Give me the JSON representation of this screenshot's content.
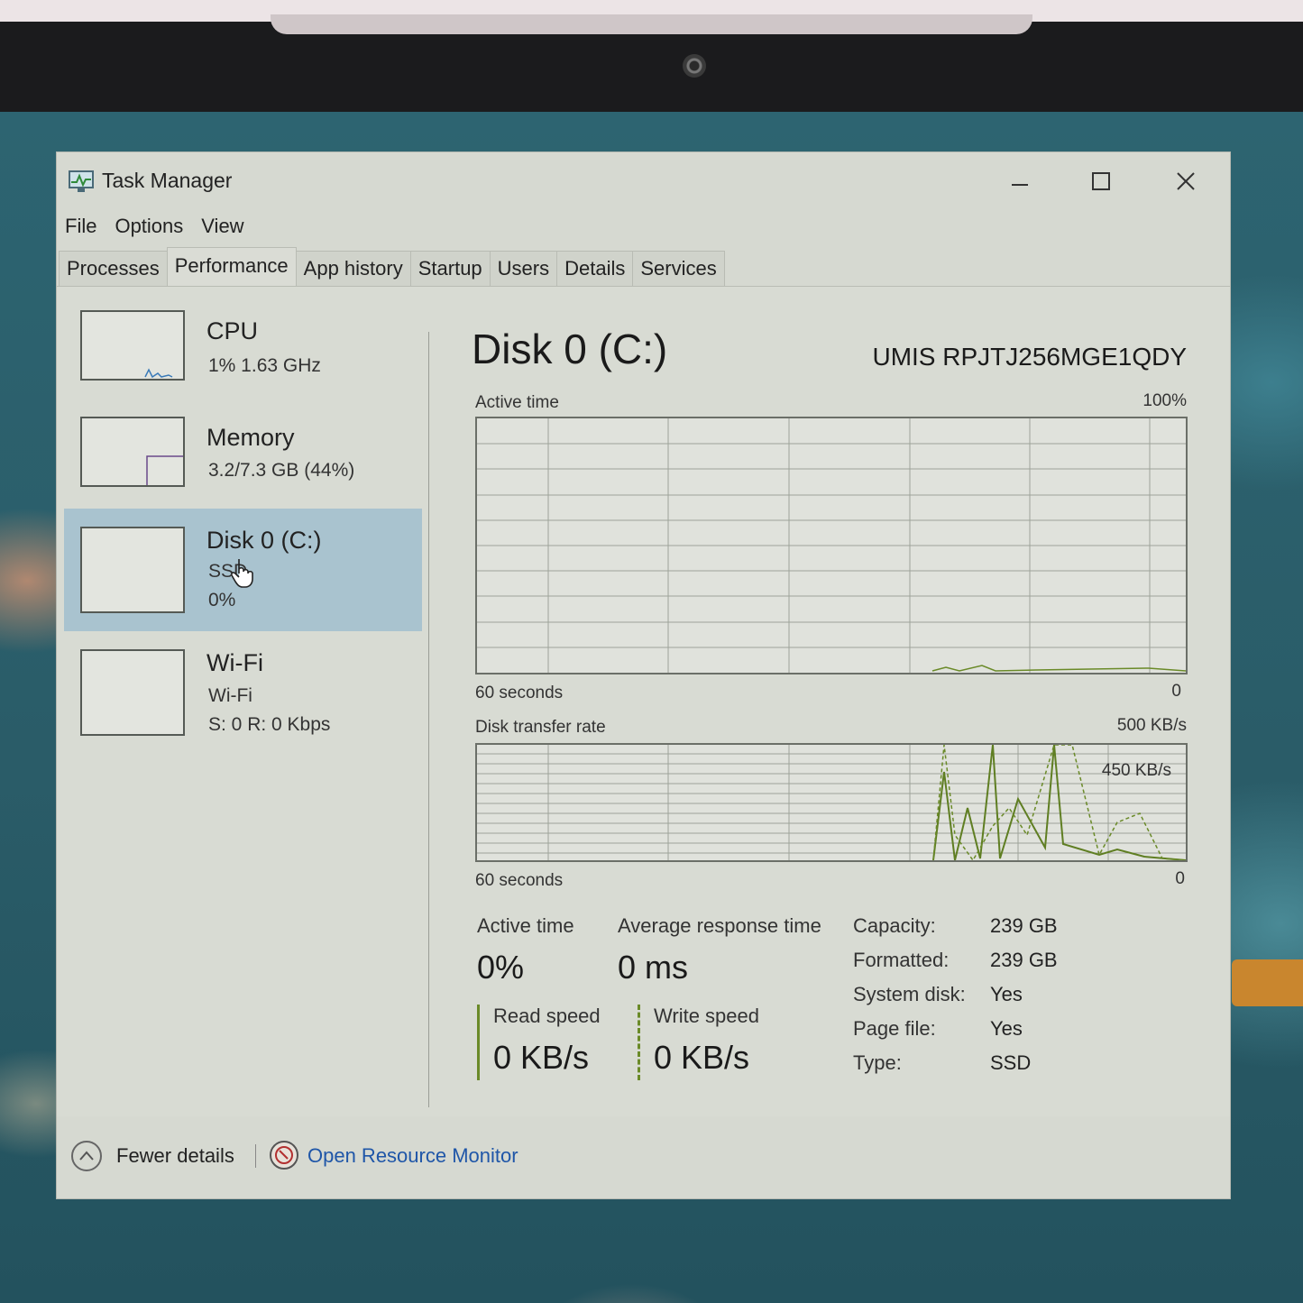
{
  "window": {
    "title": "Task Manager"
  },
  "menu": [
    "File",
    "Options",
    "View"
  ],
  "tabs": [
    {
      "label": "Processes"
    },
    {
      "label": "Performance",
      "active": true
    },
    {
      "label": "App history"
    },
    {
      "label": "Startup"
    },
    {
      "label": "Users"
    },
    {
      "label": "Details"
    },
    {
      "label": "Services"
    }
  ],
  "sidebar": [
    {
      "title": "CPU",
      "line1": "1%  1.63 GHz",
      "line2": ""
    },
    {
      "title": "Memory",
      "line1": "3.2/7.3 GB (44%)",
      "line2": ""
    },
    {
      "title": "Disk 0 (C:)",
      "line1": "SSD",
      "line2": "0%",
      "selected": true
    },
    {
      "title": "Wi-Fi",
      "line1": "Wi-Fi",
      "line2": "S: 0  R: 0 Kbps"
    }
  ],
  "disk": {
    "title": "Disk 0 (C:)",
    "model": "UMIS RPJTJ256MGE1QDY",
    "active_chart": {
      "label": "Active time",
      "max": "100%",
      "time": "60 seconds",
      "min": "0"
    },
    "transfer_chart": {
      "label": "Disk transfer rate",
      "max": "500 KB/s",
      "marker": "450 KB/s",
      "time": "60 seconds",
      "min": "0"
    },
    "stats": {
      "active_time_label": "Active time",
      "active_time_value": "0%",
      "avg_resp_label": "Average response time",
      "avg_resp_value": "0 ms",
      "read_label": "Read speed",
      "read_value": "0 KB/s",
      "write_label": "Write speed",
      "write_value": "0 KB/s"
    },
    "properties": [
      {
        "key": "Capacity:",
        "value": "239 GB"
      },
      {
        "key": "Formatted:",
        "value": "239 GB"
      },
      {
        "key": "System disk:",
        "value": "Yes"
      },
      {
        "key": "Page file:",
        "value": "Yes"
      },
      {
        "key": "Type:",
        "value": "SSD"
      }
    ]
  },
  "footer": {
    "fewer_details": "Fewer details",
    "resource_monitor": "Open Resource Monitor"
  },
  "colors": {
    "accent_series": "#6a8a28",
    "selected_bg": "#a9c3cf",
    "link": "#1f56a8"
  }
}
